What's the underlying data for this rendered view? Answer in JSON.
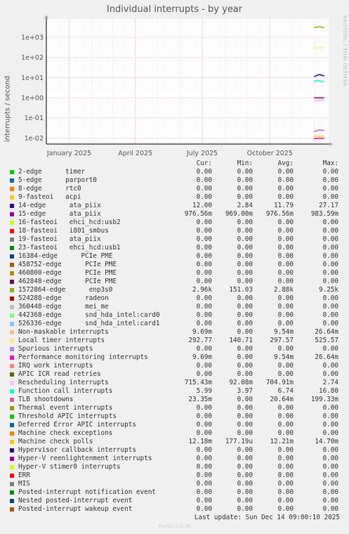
{
  "title": "Individual interrupts - by year",
  "side_label": "RRDTOOL / TOBI OETIKER",
  "y_axis_label": "interrupts / second",
  "headers": [
    "Cur:",
    "Min:",
    "Avg:",
    "Max:"
  ],
  "legend": [
    {
      "label": "2-edge      timer",
      "color": "#00cc00",
      "cur": "0.00",
      "min": "0.00",
      "avg": "0.00",
      "max": "0.00"
    },
    {
      "label": "5-edge      parport0",
      "color": "#0066b3",
      "cur": "0.00",
      "min": "0.00",
      "avg": "0.00",
      "max": "0.00"
    },
    {
      "label": "8-edge      rtc0",
      "color": "#ff8000",
      "cur": "0.00",
      "min": "0.00",
      "avg": "0.00",
      "max": "0.00"
    },
    {
      "label": "9-fasteoi   acpi",
      "color": "#ffcc00",
      "cur": "0.00",
      "min": "0.00",
      "avg": "0.00",
      "max": "0.00"
    },
    {
      "label": "14-edge      ata_piix",
      "color": "#330099",
      "cur": "12.00",
      "min": "2.84",
      "avg": "11.79",
      "max": "27.17"
    },
    {
      "label": "15-edge      ata_piix",
      "color": "#990099",
      "cur": "976.56m",
      "min": "969.00m",
      "avg": "976.56m",
      "max": "983.59m"
    },
    {
      "label": "16-fasteoi   ehci_hcd:usb2",
      "color": "#ccff00",
      "cur": "0.00",
      "min": "0.00",
      "avg": "0.00",
      "max": "0.00"
    },
    {
      "label": "18-fasteoi   i801_smbus",
      "color": "#ff0000",
      "cur": "0.00",
      "min": "0.00",
      "avg": "0.00",
      "max": "0.00"
    },
    {
      "label": "19-fasteoi   ata_piix",
      "color": "#808080",
      "cur": "0.00",
      "min": "0.00",
      "avg": "0.00",
      "max": "0.00"
    },
    {
      "label": "23-fasteoi   ehci_hcd:usb1",
      "color": "#008f00",
      "cur": "0.00",
      "min": "0.00",
      "avg": "0.00",
      "max": "0.00"
    },
    {
      "label": "16384-edge      PCIe PME",
      "color": "#00487d",
      "cur": "0.00",
      "min": "0.00",
      "avg": "0.00",
      "max": "0.00"
    },
    {
      "label": "458752-edge      PCIe PME",
      "color": "#b35a00",
      "cur": "0.00",
      "min": "0.00",
      "avg": "0.00",
      "max": "0.00"
    },
    {
      "label": "460800-edge      PCIe PME",
      "color": "#b38f00",
      "cur": "0.00",
      "min": "0.00",
      "avg": "0.00",
      "max": "0.00"
    },
    {
      "label": "462848-edge      PCIe PME",
      "color": "#6b006b",
      "cur": "0.00",
      "min": "0.00",
      "avg": "0.00",
      "max": "0.00"
    },
    {
      "label": "1572864-edge      enp3s0",
      "color": "#8fb300",
      "cur": "2.96k",
      "min": "151.03",
      "avg": "2.88k",
      "max": "9.25k"
    },
    {
      "label": "524288-edge      radeon",
      "color": "#b30000",
      "cur": "0.00",
      "min": "0.00",
      "avg": "0.00",
      "max": "0.00"
    },
    {
      "label": "360448-edge      mei_me",
      "color": "#bebebe",
      "cur": "0.00",
      "min": "0.00",
      "avg": "0.00",
      "max": "0.00"
    },
    {
      "label": "442368-edge      snd_hda_intel:card0",
      "color": "#80ff80",
      "cur": "0.00",
      "min": "0.00",
      "avg": "0.00",
      "max": "0.00"
    },
    {
      "label": "526336-edge      snd_hda_intel:card1",
      "color": "#80c9ff",
      "cur": "0.00",
      "min": "0.00",
      "avg": "0.00",
      "max": "0.00"
    },
    {
      "label": "Non-maskable interrupts",
      "color": "#ffc080",
      "cur": "9.69m",
      "min": "0.00",
      "avg": "9.54m",
      "max": "26.64m"
    },
    {
      "label": "Local timer interrupts",
      "color": "#ffe680",
      "cur": "292.77",
      "min": "140.71",
      "avg": "297.57",
      "max": "525.57"
    },
    {
      "label": "Spurious interrupts",
      "color": "#aa80ff",
      "cur": "0.00",
      "min": "0.00",
      "avg": "0.00",
      "max": "0.00"
    },
    {
      "label": "Performance monitoring interrupts",
      "color": "#ee00cc",
      "cur": "9.69m",
      "min": "0.00",
      "avg": "9.54m",
      "max": "26.64m"
    },
    {
      "label": "IRQ work interrupts",
      "color": "#ff8080",
      "cur": "0.00",
      "min": "0.00",
      "avg": "0.00",
      "max": "0.00"
    },
    {
      "label": "APIC ICR read retries",
      "color": "#666600",
      "cur": "0.00",
      "min": "0.00",
      "avg": "0.00",
      "max": "0.00"
    },
    {
      "label": "Rescheduling interrupts",
      "color": "#ffbfff",
      "cur": "715.43m",
      "min": "92.08m",
      "avg": "704.91m",
      "max": "2.74"
    },
    {
      "label": "Function call interrupts",
      "color": "#00ffcc",
      "cur": "5.99",
      "min": "3.97",
      "avg": "6.74",
      "max": "16.80"
    },
    {
      "label": "TLB shootdowns",
      "color": "#cc6699",
      "cur": "23.35m",
      "min": "0.00",
      "avg": "20.64m",
      "max": "199.33m"
    },
    {
      "label": "Thermal event interrupts",
      "color": "#999900",
      "cur": "0.00",
      "min": "0.00",
      "avg": "0.00",
      "max": "0.00"
    },
    {
      "label": "Threshold APIC interrupts",
      "color": "#00cc00",
      "cur": "0.00",
      "min": "0.00",
      "avg": "0.00",
      "max": "0.00"
    },
    {
      "label": "Deferred Error APIC interrupts",
      "color": "#0066b3",
      "cur": "0.00",
      "min": "0.00",
      "avg": "0.00",
      "max": "0.00"
    },
    {
      "label": "Machine check exceptions",
      "color": "#ff8000",
      "cur": "0.00",
      "min": "0.00",
      "avg": "0.00",
      "max": "0.00"
    },
    {
      "label": "Machine check polls",
      "color": "#ffcc00",
      "cur": "12.18m",
      "min": "177.19u",
      "avg": "12.21m",
      "max": "14.70m"
    },
    {
      "label": "Hypervisor callback interrupts",
      "color": "#330099",
      "cur": "0.00",
      "min": "0.00",
      "avg": "0.00",
      "max": "0.00"
    },
    {
      "label": "Hyper-V reenlightenment interrupts",
      "color": "#990099",
      "cur": "0.00",
      "min": "0.00",
      "avg": "0.00",
      "max": "0.00"
    },
    {
      "label": "Hyper-V stimer0 interrupts",
      "color": "#ccff00",
      "cur": "0.00",
      "min": "0.00",
      "avg": "0.00",
      "max": "0.00"
    },
    {
      "label": "ERR",
      "color": "#ff0000",
      "cur": "0.00",
      "min": "0.00",
      "avg": "0.00",
      "max": "0.00"
    },
    {
      "label": "MIS",
      "color": "#808080",
      "cur": "0.00",
      "min": "0.00",
      "avg": "0.00",
      "max": "0.00"
    },
    {
      "label": "Posted-interrupt notification event",
      "color": "#008f00",
      "cur": "0.00",
      "min": "0.00",
      "avg": "0.00",
      "max": "0.00"
    },
    {
      "label": "Nested posted-interrupt event",
      "color": "#00487d",
      "cur": "0.00",
      "min": "0.00",
      "avg": "0.00",
      "max": "0.00"
    },
    {
      "label": "Posted-interrupt wakeup event",
      "color": "#b35a00",
      "cur": "0.00",
      "min": "0.00",
      "avg": "0.00",
      "max": "0.00"
    }
  ],
  "footer": "Last update: Sun Dec 14 09:00:10 2025",
  "munin_version": "Munin 2.0.76",
  "chart_data": {
    "type": "line",
    "title": "Individual interrupts - by year",
    "ylabel": "interrupts / second",
    "yscale": "log",
    "ylim": [
      0.005,
      8000
    ],
    "yticks": [
      {
        "value": 0.01,
        "label": "1e-02"
      },
      {
        "value": 0.1,
        "label": "1e-01"
      },
      {
        "value": 1,
        "label": "1e+00"
      },
      {
        "value": 10,
        "label": "1e+01"
      },
      {
        "value": 100,
        "label": "1e+02"
      },
      {
        "value": 1000,
        "label": "1e+03"
      }
    ],
    "xlim": [
      "2024-12-01",
      "2025-12-20"
    ],
    "xticks": [
      {
        "date": "2025-01-01",
        "label": "January 2025"
      },
      {
        "date": "2025-04-01",
        "label": "April 2025"
      },
      {
        "date": "2025-07-01",
        "label": "July 2025"
      },
      {
        "date": "2025-10-01",
        "label": "October 2025"
      }
    ],
    "grid": true,
    "series": [
      {
        "name": "1572864-edge enp3s0",
        "color": "#8fb300",
        "x": [
          "2025-11-30",
          "2025-12-07",
          "2025-12-14"
        ],
        "y": [
          3000,
          3300,
          2960
        ]
      },
      {
        "name": "Local timer interrupts",
        "color": "#ffe680",
        "x": [
          "2025-11-30",
          "2025-12-07",
          "2025-12-14"
        ],
        "y": [
          300,
          290,
          292.77
        ]
      },
      {
        "name": "14-edge ata_piix",
        "color": "#330099",
        "x": [
          "2025-11-30",
          "2025-12-07",
          "2025-12-14"
        ],
        "y": [
          11,
          14,
          12
        ]
      },
      {
        "name": "Function call interrupts",
        "color": "#00ffcc",
        "x": [
          "2025-11-30",
          "2025-12-07",
          "2025-12-14"
        ],
        "y": [
          6.5,
          7,
          5.99
        ]
      },
      {
        "name": "15-edge ata_piix",
        "color": "#990099",
        "x": [
          "2025-11-30",
          "2025-12-07",
          "2025-12-14"
        ],
        "y": [
          0.977,
          0.977,
          0.977
        ]
      },
      {
        "name": "Rescheduling interrupts",
        "color": "#ffbfff",
        "x": [
          "2025-11-30",
          "2025-12-07",
          "2025-12-14"
        ],
        "y": [
          0.7,
          0.72,
          0.715
        ]
      },
      {
        "name": "TLB shootdowns",
        "color": "#cc6699",
        "x": [
          "2025-11-30",
          "2025-12-07",
          "2025-12-14"
        ],
        "y": [
          0.02,
          0.025,
          0.0234
        ]
      },
      {
        "name": "Machine check polls",
        "color": "#ffcc00",
        "x": [
          "2025-11-30",
          "2025-12-07",
          "2025-12-14"
        ],
        "y": [
          0.0122,
          0.0122,
          0.0122
        ]
      },
      {
        "name": "Non-maskable interrupts",
        "color": "#ffc080",
        "x": [
          "2025-11-30",
          "2025-12-07",
          "2025-12-14"
        ],
        "y": [
          0.0095,
          0.0098,
          0.0097
        ]
      },
      {
        "name": "Performance monitoring interrupts",
        "color": "#ee00cc",
        "x": [
          "2025-11-30",
          "2025-12-07",
          "2025-12-14"
        ],
        "y": [
          0.0093,
          0.0096,
          0.0097
        ]
      }
    ]
  }
}
